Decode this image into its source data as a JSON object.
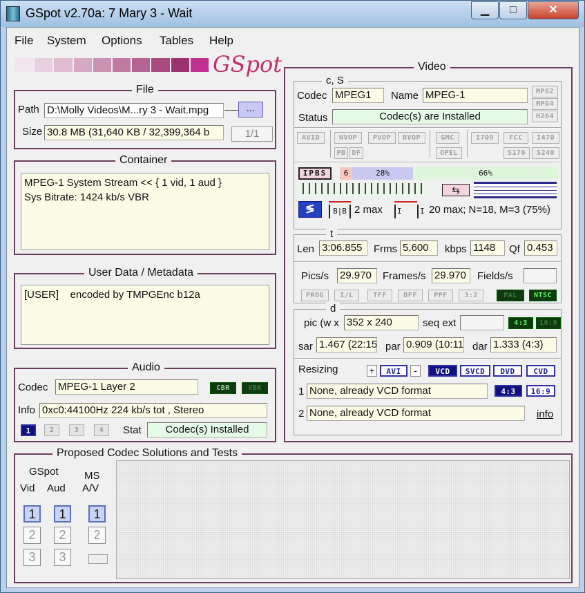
{
  "window": {
    "title": "GSpot v2.70a: 7 Mary 3 - Wait",
    "minimize": "▁",
    "maximize": "□",
    "close": "✕"
  },
  "menu": [
    "File",
    "System",
    "Options",
    "Tables",
    "Help"
  ],
  "logo": "GSpot",
  "file": {
    "title": "File",
    "path_label": "Path",
    "path_value": "D:\\Molly Videos\\M...ry 3 - Wait.mpg",
    "browse": "...",
    "size_label": "Size",
    "size_value": "30.8 MB (31,640 KB / 32,399,364 b",
    "page": "1/1"
  },
  "container": {
    "title": "Container",
    "text": "MPEG-1 System Stream << { 1 vid, 1 aud }\nSys Bitrate: 1424 kb/s VBR"
  },
  "userdata": {
    "title": "User Data / Metadata",
    "text": "[USER]    encoded by TMPGEnc b12a"
  },
  "audio": {
    "title": "Audio",
    "codec_label": "Codec",
    "codec_value": "MPEG-1 Layer 2",
    "cbr": "CBR",
    "vbr": "VBR",
    "info_label": "Info",
    "info_value": "0xc0:44100Hz  224 kb/s tot , Stereo",
    "tracks": [
      "1",
      "2",
      "3",
      "4"
    ],
    "stat_label": "Stat",
    "stat_value": "Codec(s) Installed"
  },
  "video": {
    "title": "Video",
    "cs_title": "c, S",
    "codec_label": "Codec",
    "codec_value": "MPEG1",
    "name_label": "Name",
    "name_value": "MPEG-1",
    "side": [
      "MPG2",
      "MPG4",
      "H264"
    ],
    "status_label": "Status",
    "status_value": "Codec(s) are Installed",
    "flags1": [
      "AVID",
      "NVOP",
      "PVOP",
      "BVOP",
      "GMC",
      "I709",
      "FCC",
      "I470"
    ],
    "flags2": [
      "PB",
      "DF",
      "OPEL",
      "S170",
      "S240"
    ],
    "gop": {
      "ipbs": "IPBS",
      "p6": "6",
      "p28": "28%",
      "p66": "66%",
      "bb": "B|B",
      "bmax": "2 max",
      "imax": "20 max; N=18, M=3 (75%)",
      "ia": "I",
      "ib": "I"
    },
    "t_title": "t",
    "len_label": "Len",
    "len_value": "3:06.855",
    "frms_label": "Frms",
    "frms_value": "5,600",
    "kbps_label": "kbps",
    "kbps_value": "1148",
    "qf_label": "Qf",
    "qf_value": "0.453",
    "pics_label": "Pics/s",
    "pics_value": "29.970",
    "frames_label": "Frames/s",
    "frames_value": "29.970",
    "fields_label": "Fields/s",
    "fields_value": "",
    "scan": [
      "PROG",
      "I/L",
      "TFF",
      "BFF",
      "PPF",
      "3:2"
    ],
    "pal": "PAL",
    "ntsc": "NTSC",
    "d_title": "d",
    "pic_label": "pic (w x",
    "pic_value": "352 x 240",
    "seq_label": "seq ext",
    "seq_value": "",
    "ar43": "4:3",
    "ar169": "16:9",
    "sar_label": "sar",
    "sar_value": "1.467 (22:15",
    "par_label": "par",
    "par_value": "0.909 (10:11",
    "dar_label": "dar",
    "dar_value": "1.333 (4:3)",
    "resizing_label": "Resizing",
    "plus": "+",
    "minus": "-",
    "avi": "AVI",
    "fmts": [
      "VCD",
      "SVCD",
      "DVD",
      "CVD"
    ],
    "r1_label": "1",
    "r1_value": "None, already VCD format",
    "r2_label": "2",
    "r2_value": "None, already VCD format",
    "ar43b": "4:3",
    "ar169b": "16:9",
    "info": "info"
  },
  "proposed": {
    "title": "Proposed Codec Solutions and Tests",
    "gspot": "GSpot",
    "vid": "Vid",
    "aud": "Aud",
    "ms": "MS",
    "av": "A/V",
    "nums": [
      "1",
      "2",
      "3"
    ]
  }
}
